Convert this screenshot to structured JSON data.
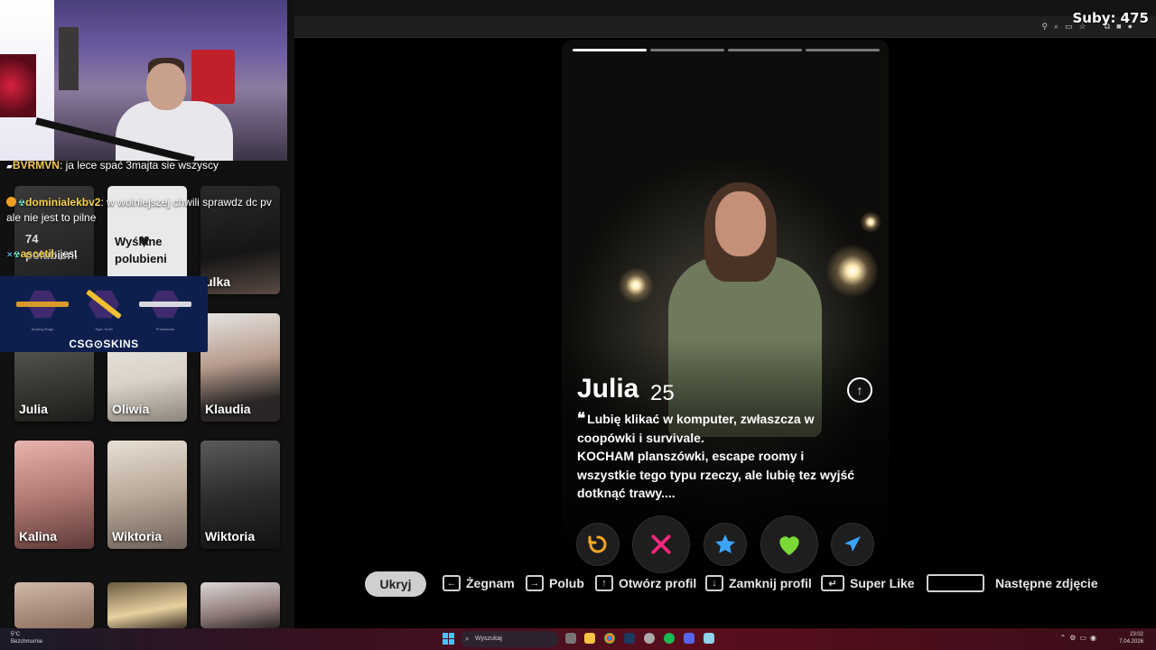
{
  "stream": {
    "subs_label": "Suby: 475",
    "chat": [
      {
        "user": "BVRMVN",
        "message": ": ja lece spać 3majta sie wszyscy"
      },
      {
        "user": "dominialekbv2",
        "message": ": w wolniejszej chwili sprawdz dc pv ale nie jest to pilne"
      },
      {
        "user": "ascetil",
        "message": ": jest"
      }
    ],
    "sponsor": {
      "brand": "CSG⊙SKINS",
      "items": [
        "Searing Rage",
        "Tiger Tooth",
        "Printstream"
      ]
    }
  },
  "grid": {
    "likes_label": "Wyślane polubieni",
    "likes_partial": "polubieni",
    "likes_count": "74",
    "profiles": [
      {
        "name": "ulka"
      },
      {
        "name": "Julia"
      },
      {
        "name": "Oliwia"
      },
      {
        "name": "Klaudia"
      },
      {
        "name": "Kalina"
      },
      {
        "name": "Wiktoria"
      },
      {
        "name": "Wiktoria"
      }
    ]
  },
  "profile": {
    "name": "Julia",
    "age": "25",
    "bio_line1": "Lubię klikać w komputer, zwłaszcza w coopówki i survivale.",
    "bio_line2": "KOCHAM planszówki, escape roomy i wszystkie tego typu rzeczy, ale lubię tez wyjść dotknąć trawy....",
    "photo_count": 4,
    "photo_index": 1
  },
  "actions": [
    {
      "name": "rewind",
      "icon": "rewind-icon",
      "color": "#f5a623"
    },
    {
      "name": "nope",
      "icon": "x-icon",
      "color": "#fd267d"
    },
    {
      "name": "super-like",
      "icon": "star-icon",
      "color": "#3ca4ff"
    },
    {
      "name": "like",
      "icon": "heart-icon",
      "color": "#7bd937"
    },
    {
      "name": "boost",
      "icon": "send-icon",
      "color": "#3ca4ff"
    }
  ],
  "hints": {
    "hide_label": "Ukryj",
    "nope": "Żegnam",
    "like": "Polub",
    "open_profile": "Otwórz profil",
    "close_profile": "Zamknij profil",
    "super_like": "Super Like",
    "next_photo": "Następne zdjęcie"
  },
  "taskbar": {
    "weather_temp": "5°C",
    "weather_desc": "Bezchmurnie",
    "search_placeholder": "Wyszukaj",
    "time": "23:02",
    "date": "7.04.2026"
  }
}
